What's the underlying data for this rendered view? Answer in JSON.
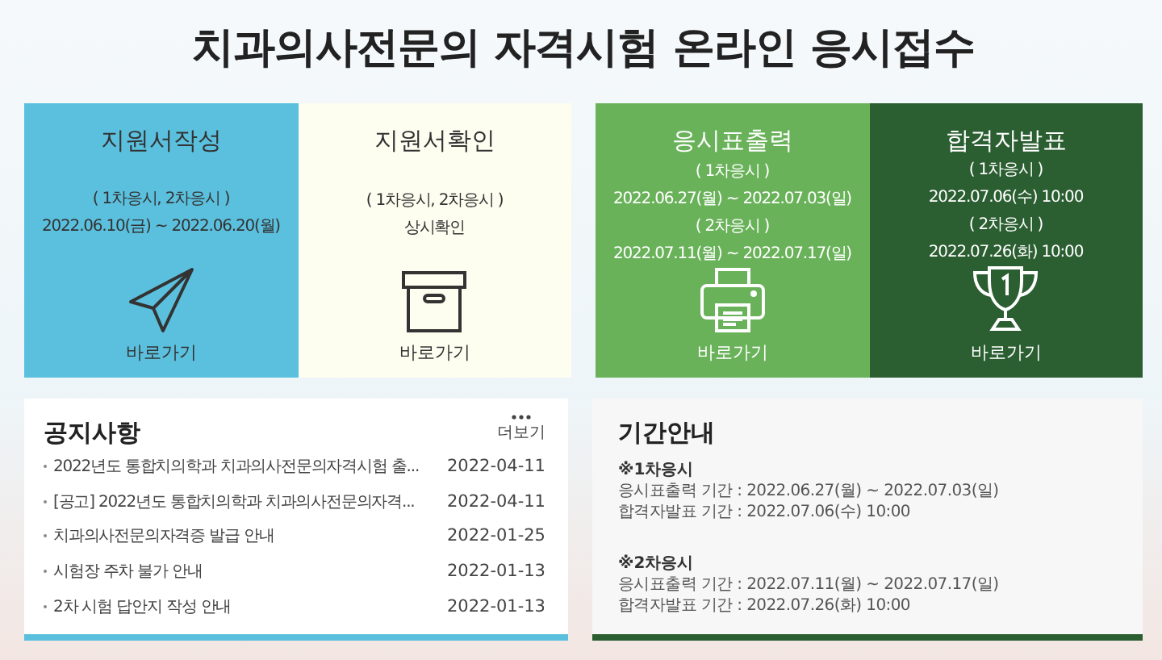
{
  "page_title": "치과의사전문의 자격시험 온라인 응시접수",
  "cards": [
    {
      "title": "지원서작성",
      "color": "#5bc0de",
      "lines": [
        "( 1차응시, 2차응시 )",
        "2022.06.10(금) ~ 2022.06.20(월)"
      ],
      "link": "바로가기"
    },
    {
      "title": "지원서확인",
      "color": "#fdfdf0",
      "lines": [
        "( 1차응시, 2차응시 )",
        "상시확인"
      ],
      "link": "바로가기"
    },
    {
      "title": "응시표출력",
      "color": "#6ab25a",
      "lines": [
        "( 1차응시 )",
        "2022.06.27(월) ~ 2022.07.03(일)",
        "( 2차응시 )",
        "2022.07.11(월) ~ 2022.07.17(일)"
      ],
      "link": "바로가기"
    },
    {
      "title": "합격자발표",
      "color": "#2b5e31",
      "lines": [
        "( 1차응시 )",
        "2022.07.06(수) 10:00",
        "( 2차응시 )",
        "2022.07.26(화) 10:00"
      ],
      "link": "바로가기"
    }
  ],
  "notices": {
    "title": "공지사항",
    "more": "더보기",
    "items": [
      {
        "text": "2022년도 통합치의학과 치과의사전문의자격시험 출...",
        "date": "2022-04-11"
      },
      {
        "text": "[공고] 2022년도 통합치의학과 치과의사전문의자격...",
        "date": "2022-04-11"
      },
      {
        "text": "치과의사전문의자격증 발급 안내",
        "date": "2022-01-25"
      },
      {
        "text": "시험장 주차 불가 안내",
        "date": "2022-01-13"
      },
      {
        "text": "2차 시험 답안지 작성 안내",
        "date": "2022-01-13"
      }
    ]
  },
  "periods": {
    "title": "기간안내",
    "sections": [
      {
        "heading": "※1차응시",
        "lines": [
          "응시표출력 기간 : 2022.06.27(월) ~ 2022.07.03(일)",
          "합격자발표 기간 : 2022.07.06(수) 10:00"
        ]
      },
      {
        "heading": "※2차응시",
        "lines": [
          "응시표출력 기간 : 2022.07.11(월) ~ 2022.07.17(일)",
          "합격자발표 기간 : 2022.07.26(화) 10:00"
        ]
      }
    ]
  }
}
